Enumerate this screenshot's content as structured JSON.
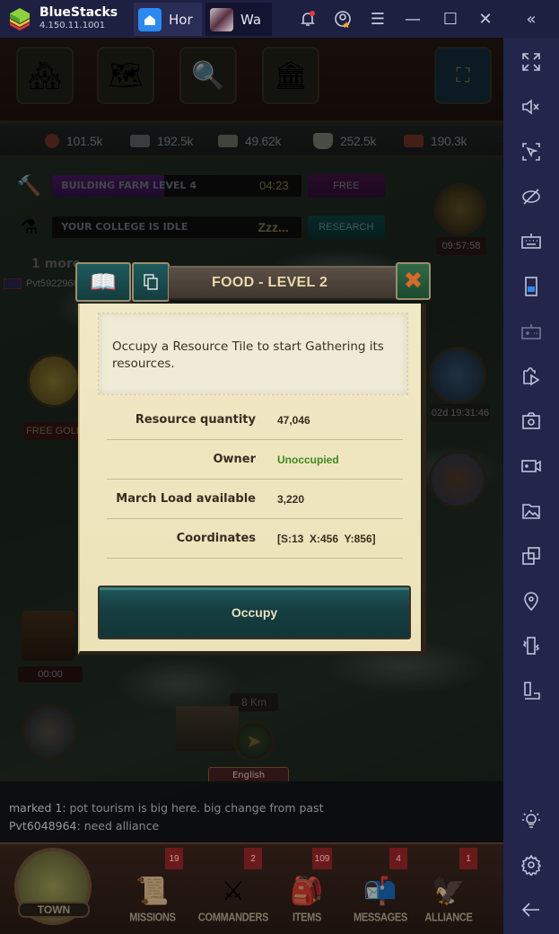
{
  "titlebar": {
    "app_name": "BlueStacks",
    "version": "4.150.11.1001",
    "tabs": [
      {
        "label": "Hor",
        "icon": "home-icon"
      },
      {
        "label": "Wa",
        "icon": "game-icon"
      }
    ],
    "buttons": [
      "notification-bell-icon",
      "account-icon",
      "menu-icon",
      "minimize-icon",
      "maximize-icon",
      "close-icon",
      "collapse-sidebar-icon"
    ]
  },
  "game": {
    "top_buttons": [
      "town-buildings",
      "campaign-map",
      "search",
      "capitol",
      "fullscreen-frame"
    ],
    "resources": [
      {
        "name": "food",
        "value": "101.5k"
      },
      {
        "name": "iron",
        "value": "192.5k"
      },
      {
        "name": "silver",
        "value": "49.62k"
      },
      {
        "name": "cotton",
        "value": "252.5k"
      },
      {
        "name": "lumber",
        "value": "190.3k"
      }
    ],
    "queues": [
      {
        "label": "BUILDING FARM LEVEL 4",
        "time": "04:23",
        "button": "FREE",
        "progress": 0.45
      },
      {
        "label": "YOUR COLLEGE IS IDLE",
        "time": "Zzz...",
        "button": "RESEARCH",
        "progress": 0
      }
    ],
    "side": {
      "medal_timer": "09:57:58",
      "event_timer": "02d 19:31:46",
      "chest_timer": "00:00",
      "free_gold": "FREE GOLD",
      "distance": "8 Km",
      "more": "1 more",
      "player": "Pvt5922968"
    },
    "language": "English",
    "chat": [
      {
        "who": "marked 1:",
        "msg": " pot tourism is big here. big change from past"
      },
      {
        "who": "Pvt6048964:",
        "msg": " need alliance"
      }
    ],
    "nav": [
      {
        "label": "TOWN",
        "badge": ""
      },
      {
        "label": "MISSIONS",
        "badge": "19"
      },
      {
        "label": "COMMANDERS",
        "badge": "2"
      },
      {
        "label": "ITEMS",
        "badge": "109"
      },
      {
        "label": "MESSAGES",
        "badge": "4"
      },
      {
        "label": "ALLIANCE",
        "badge": "1"
      }
    ]
  },
  "dialog": {
    "title": "FOOD - LEVEL 2",
    "description": "Occupy a Resource Tile to start Gathering its resources.",
    "rows": [
      {
        "key": "Resource quantity",
        "value": "47,046"
      },
      {
        "key": "Owner",
        "value": "Unoccupied"
      },
      {
        "key": "March Load available",
        "value": "3,220"
      },
      {
        "key": "Coordinates",
        "value": "[S:13  X:456  Y:856]"
      }
    ],
    "action": "Occupy"
  },
  "sidebar": {
    "icons": [
      "fullscreen-icon",
      "mute-icon",
      "pointer-lock-icon",
      "hide-icon",
      "keyboard-icon",
      "phone-icon",
      "gamepad-icon",
      "media-import-icon",
      "screenshot-icon",
      "record-icon",
      "gallery-icon",
      "multi-instance-icon",
      "location-icon",
      "shake-icon",
      "rotate-icon",
      "tips-icon",
      "settings-icon",
      "back-icon"
    ]
  }
}
